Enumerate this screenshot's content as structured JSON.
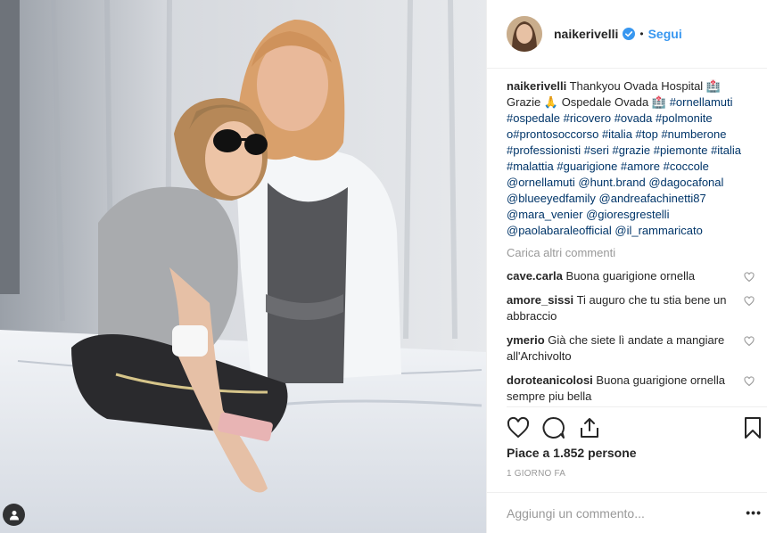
{
  "post": {
    "username": "naikerivelli",
    "follow_label": "Segui",
    "dot": "•",
    "caption_text": "Thankyou Ovada Hospital 🏥 Grazie 🙏 Ospedale Ovada 🏥",
    "caption_tags": "#ornellamuti #ospedale #ricovero #ovada #polmonite o#prontosoccorso #italia #top #numberone #professionisti #seri #grazie #piemonte #italia #malattia #guarigione #amore #coccole @ornellamuti @hunt.brand @dagocafonal @blueeyedfamily @andreafachinetti87 @mara_venier @gioresgrestelli @paolabaraleofficial @il_rammaricato",
    "load_more": "Carica altri commenti",
    "comments": [
      {
        "user": "cave.carla",
        "text": "Buona guarigione ornella"
      },
      {
        "user": "amore_sissi",
        "text": "Ti auguro che tu stia bene un abbraccio"
      },
      {
        "user": "ymerio",
        "text": "Già che siete lì andate a mangiare all'Archivolto"
      },
      {
        "user": "doroteanicolosi",
        "text": "Buona guarigione ornella sempre piu bella"
      }
    ],
    "likes": "Piace a 1.852 persone",
    "date": "1 GIORNO FA",
    "add_comment_placeholder": "Aggiungi un commento...",
    "more": "•••"
  },
  "colors": {
    "link": "#3897f0",
    "hashtag": "#003569",
    "muted": "#999999"
  },
  "icons": [
    "user-tag-icon",
    "verified-badge-icon",
    "heart-icon",
    "comment-icon",
    "share-icon",
    "bookmark-icon"
  ]
}
